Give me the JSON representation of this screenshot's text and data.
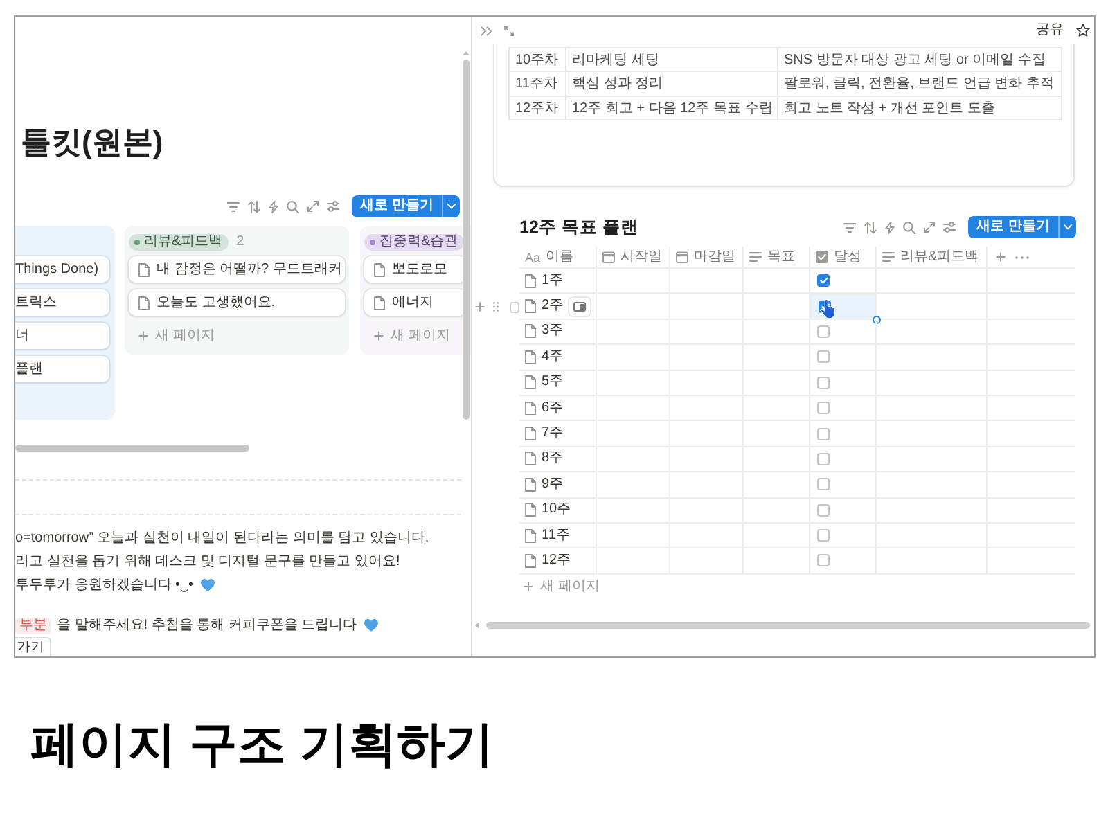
{
  "left_pane": {
    "title": "툴킷(원본)",
    "toolbar": {
      "new_button": "새로 만들기"
    },
    "board": {
      "columns": [
        {
          "kind": "headless",
          "color": "#ebf4fb",
          "cards": [
            "Things Done)",
            "트릭스",
            "너",
            "플랜"
          ]
        },
        {
          "kind": "tagged",
          "tag": "리뷰&피드백",
          "color": "#6b9e7c",
          "count": "2",
          "cards": [
            "내 감정은 어떨까? 무드트래커",
            "오늘도 고생했어요."
          ],
          "new_page": "새 페이지"
        },
        {
          "kind": "tagged",
          "tag": "집중력&습관",
          "color": "#a27ec8",
          "cards": [
            "뽀도로모",
            "에너지"
          ],
          "new_page": "새 페이지"
        }
      ]
    },
    "paragraphs": [
      {
        "text": "o=tomorrow” 오늘과 실천이 내일이 된다라는 의미를 담고 있습니다.",
        "heart": false
      },
      {
        "text": "리고 실천을 돕기 위해 데스크 및 디지털 문구를 만들고 있어요!",
        "heart": false
      },
      {
        "text": "투두투가 응원하겠습니다 •‿•",
        "heart": true
      },
      {
        "code": "부분",
        "text": "을 말해주세요! 추첨을 통해 커피쿠폰을 드립니다",
        "heart": true
      }
    ],
    "go_button": "가기"
  },
  "right_pane": {
    "topbar": {
      "share": "공유"
    },
    "embedded_table": {
      "rows": [
        [
          "10주차",
          "리마케팅 세팅",
          "SNS 방문자 대상 광고 세팅 or 이메일 수집"
        ],
        [
          "11주차",
          "핵심 성과 정리",
          "팔로워, 클릭, 전환율, 브랜드 언급 변화 추적"
        ],
        [
          "12주차",
          "12주 회고 + 다음 12주 목표 수립",
          "회고 노트 작성 + 개선 포인트 도출"
        ]
      ]
    },
    "database": {
      "title": "12주 목표 플랜",
      "new_button": "새로 만들기",
      "columns": [
        {
          "kind": "title",
          "glyph": "Aa",
          "label": "이름"
        },
        {
          "kind": "date",
          "label": "시작일"
        },
        {
          "kind": "date",
          "label": "마감일"
        },
        {
          "kind": "text",
          "label": "목표"
        },
        {
          "kind": "checkbox",
          "label": "달성"
        },
        {
          "kind": "text",
          "label": "리뷰&피드백"
        }
      ],
      "rows": [
        {
          "name": "1주",
          "checked": true,
          "hovered": false,
          "row_checked": false,
          "selected": false
        },
        {
          "name": "2주",
          "checked": true,
          "hovered": true,
          "row_checked": false,
          "selected": true
        },
        {
          "name": "3주",
          "checked": false,
          "hovered": false,
          "row_checked": false,
          "selected": false
        },
        {
          "name": "4주",
          "checked": false,
          "hovered": false,
          "row_checked": false,
          "selected": false
        },
        {
          "name": "5주",
          "checked": false,
          "hovered": false,
          "row_checked": false,
          "selected": false
        },
        {
          "name": "6주",
          "checked": false,
          "hovered": false,
          "row_checked": false,
          "selected": false
        },
        {
          "name": "7주",
          "checked": false,
          "hovered": false,
          "row_checked": false,
          "selected": false
        },
        {
          "name": "8주",
          "checked": false,
          "hovered": false,
          "row_checked": false,
          "selected": false
        },
        {
          "name": "9주",
          "checked": false,
          "hovered": false,
          "row_checked": false,
          "selected": false
        },
        {
          "name": "10주",
          "checked": false,
          "hovered": false,
          "row_checked": false,
          "selected": false
        },
        {
          "name": "11주",
          "checked": false,
          "hovered": false,
          "row_checked": false,
          "selected": false
        },
        {
          "name": "12주",
          "checked": false,
          "hovered": false,
          "row_checked": false,
          "selected": false
        }
      ],
      "new_page": "새 페이지"
    }
  },
  "caption": "페이지 구조 기획하기"
}
